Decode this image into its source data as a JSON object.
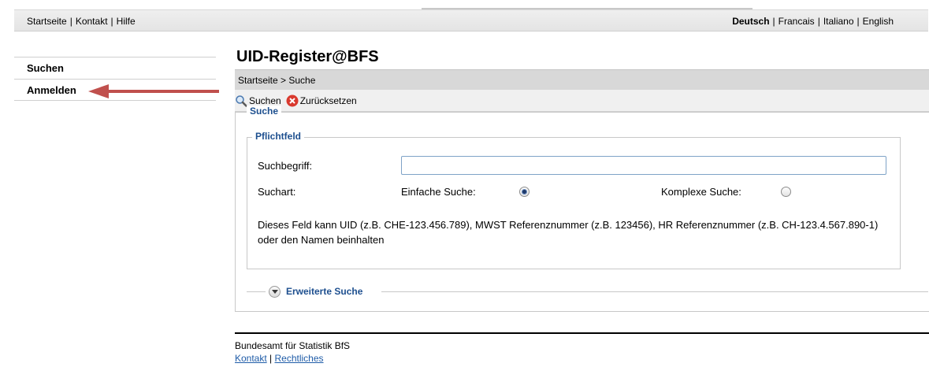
{
  "topbar": {
    "links": [
      "Startseite",
      "Kontakt",
      "Hilfe"
    ],
    "languages": [
      "Deutsch",
      "Francais",
      "Italiano",
      "English"
    ],
    "active_language": "Deutsch"
  },
  "sidebar": {
    "items": [
      {
        "label": "Suchen"
      },
      {
        "label": "Anmelden"
      }
    ]
  },
  "main": {
    "title": "UID-Register@BFS",
    "breadcrumb": "Startseite > Suche",
    "toolbar": {
      "search_label": "Suchen",
      "reset_label": "Zurücksetzen",
      "search_icon": "magnifier-icon",
      "reset_icon": "red-x-icon"
    },
    "search_section": {
      "legend": "Suche",
      "required_legend": "Pflichtfeld",
      "term_label": "Suchbegriff:",
      "term_value": "",
      "type_label": "Suchart:",
      "simple_label": "Einfache Suche:",
      "simple_checked": true,
      "complex_label": "Komplexe Suche:",
      "complex_checked": false,
      "description": "Dieses Feld kann UID (z.B. CHE-123.456.789), MWST Referenznummer (z.B. 123456), HR Referenznummer (z.B. CH-123.4.567.890-1) oder den Namen beinhalten",
      "advanced_legend": "Erweiterte Suche"
    }
  },
  "footer": {
    "org": "Bundesamt für Statistik BfS",
    "links": [
      "Kontakt",
      "Rechtliches"
    ]
  },
  "colors": {
    "legend": "#1d4f8f",
    "arrow": "#c0504d",
    "link": "#1f5ca8"
  }
}
